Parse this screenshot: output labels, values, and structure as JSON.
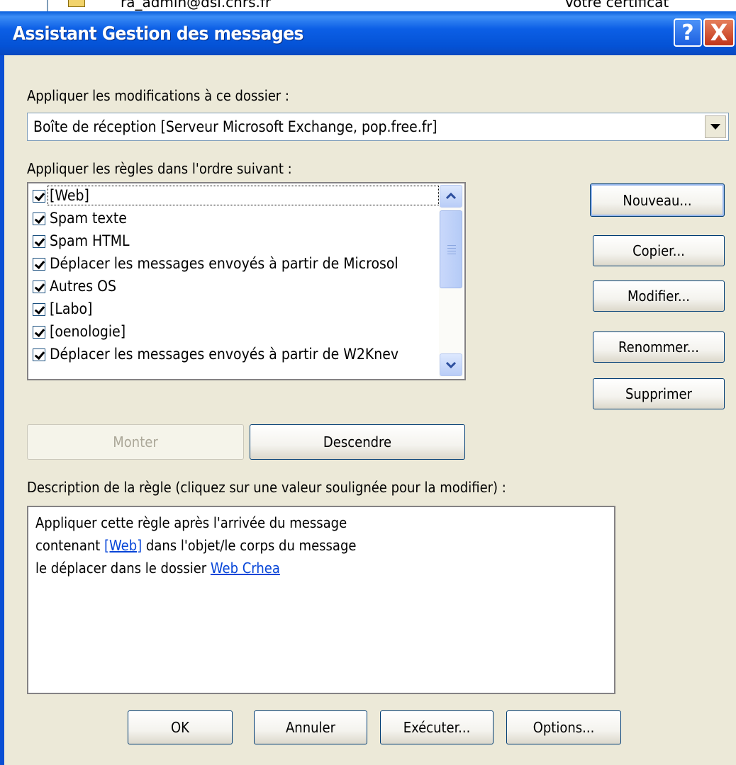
{
  "background_window": {
    "sender_text": "ra_admin@dsi.cnrs.fr",
    "subject_text": "Votre certificat"
  },
  "dialog": {
    "title": "Assistant Gestion des messages",
    "help_glyph": "?",
    "close_glyph": "X"
  },
  "folder_section": {
    "label": "Appliquer les modifications à ce dossier :",
    "selected_folder": "Boîte de réception [Serveur Microsoft Exchange, pop.free.fr]"
  },
  "rules_section": {
    "label": "Appliquer les règles dans l'ordre suivant :",
    "rules": [
      {
        "label": "[Web]",
        "checked": true
      },
      {
        "label": "Spam texte",
        "checked": true
      },
      {
        "label": "Spam HTML",
        "checked": true
      },
      {
        "label": "Déplacer les messages envoyés à partir de Microsol",
        "checked": true
      },
      {
        "label": "Autres OS",
        "checked": true
      },
      {
        "label": "[Labo]",
        "checked": true
      },
      {
        "label": "[oenologie]",
        "checked": true
      },
      {
        "label": "Déplacer les messages envoyés à partir de W2Knev",
        "checked": true
      }
    ]
  },
  "side_buttons": {
    "new": "Nouveau...",
    "copy": "Copier...",
    "modify": "Modifier...",
    "rename": "Renommer...",
    "delete": "Supprimer"
  },
  "order_buttons": {
    "up": "Monter",
    "down": "Descendre"
  },
  "description_section": {
    "label": "Description de la règle (cliquez sur une valeur soulignée pour la modifier) :",
    "line1": "Appliquer cette règle après l'arrivée du message",
    "line2_prefix": "contenant ",
    "line2_link": "[Web]",
    "line2_suffix": " dans l'objet/le corps du message",
    "line3_prefix": "le déplacer dans le dossier ",
    "line3_link": "Web Crhea"
  },
  "footer_buttons": {
    "ok": "OK",
    "cancel": "Annuler",
    "run": "Exécuter...",
    "options": "Options..."
  },
  "colors": {
    "titlebar": "#0452d5",
    "dialog_bg": "#ece9d8",
    "link": "#0645d8"
  }
}
